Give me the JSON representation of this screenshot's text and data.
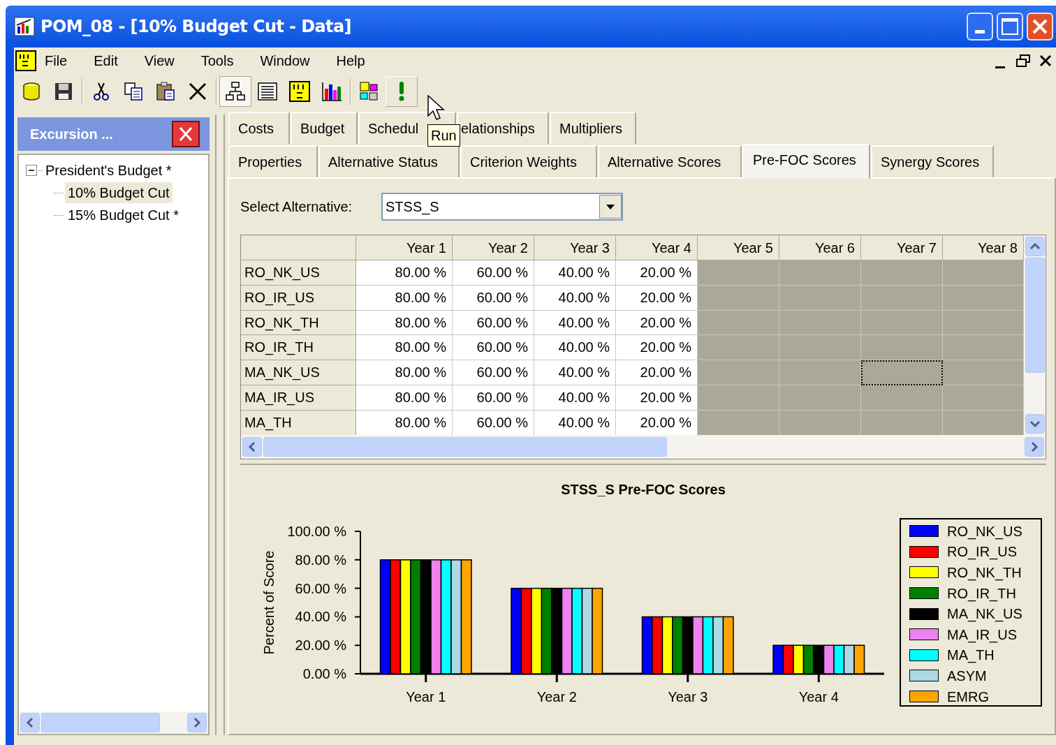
{
  "window": {
    "title": "POM_08 - [10% Budget Cut - Data]"
  },
  "menu": [
    "File",
    "Edit",
    "View",
    "Tools",
    "Window",
    "Help"
  ],
  "toolbar": [
    {
      "kind": "database",
      "pressed": false,
      "hovered": false
    },
    {
      "kind": "save",
      "pressed": false,
      "hovered": false
    },
    {
      "kind": "separator"
    },
    {
      "kind": "cut",
      "pressed": false,
      "hovered": false
    },
    {
      "kind": "copy",
      "pressed": false,
      "hovered": false
    },
    {
      "kind": "paste",
      "pressed": false,
      "hovered": false
    },
    {
      "kind": "delete",
      "pressed": false,
      "hovered": false
    },
    {
      "kind": "separator"
    },
    {
      "kind": "hierarchy",
      "pressed": true,
      "hovered": false
    },
    {
      "kind": "list",
      "pressed": false,
      "hovered": false
    },
    {
      "kind": "numbers",
      "pressed": false,
      "hovered": false
    },
    {
      "kind": "chart",
      "pressed": false,
      "hovered": false
    },
    {
      "kind": "separator"
    },
    {
      "kind": "layout",
      "pressed": false,
      "hovered": false
    },
    {
      "kind": "run",
      "pressed": false,
      "hovered": true
    }
  ],
  "tooltip": "Run",
  "excursion_panel": {
    "title": "Excursion ...",
    "tree": [
      {
        "label": "President's Budget *",
        "expanded": true,
        "selected": false,
        "children": [
          {
            "label": "10% Budget Cut",
            "selected": true
          },
          {
            "label": "15% Budget Cut *",
            "selected": false
          }
        ]
      }
    ]
  },
  "tabs": [
    [
      {
        "label": "Costs",
        "selected": false
      },
      {
        "label": "Budget",
        "selected": false
      },
      {
        "label": "Schedul",
        "selected": false
      },
      {
        "label": "elationships",
        "selected": false
      },
      {
        "label": "Multipliers",
        "selected": false
      }
    ],
    [
      {
        "label": "Properties",
        "selected": false
      },
      {
        "label": "Alternative Status",
        "selected": false
      },
      {
        "label": "Criterion Weights",
        "selected": false
      },
      {
        "label": "Alternative Scores",
        "selected": false
      },
      {
        "label": "Pre-FOC Scores",
        "selected": true
      },
      {
        "label": "Synergy Scores",
        "selected": false
      }
    ]
  ],
  "select_alternative": {
    "label": "Select Alternative:",
    "value": "STSS_S"
  },
  "grid": {
    "columns": [
      "Year 1",
      "Year 2",
      "Year 3",
      "Year 4",
      "Year 5",
      "Year 6",
      "Year 7",
      "Year 8"
    ],
    "rows": [
      {
        "name": "RO_NK_US",
        "values": [
          "80.00 %",
          "60.00 %",
          "40.00 %",
          "20.00 %"
        ],
        "focused": false
      },
      {
        "name": "RO_IR_US",
        "values": [
          "80.00 %",
          "60.00 %",
          "40.00 %",
          "20.00 %"
        ],
        "focused": false
      },
      {
        "name": "RO_NK_TH",
        "values": [
          "80.00 %",
          "60.00 %",
          "40.00 %",
          "20.00 %"
        ],
        "focused": false
      },
      {
        "name": "RO_IR_TH",
        "values": [
          "80.00 %",
          "60.00 %",
          "40.00 %",
          "20.00 %"
        ],
        "focused": false
      },
      {
        "name": "MA_NK_US",
        "values": [
          "80.00 %",
          "60.00 %",
          "40.00 %",
          "20.00 %"
        ],
        "focused": true
      },
      {
        "name": "MA_IR_US",
        "values": [
          "80.00 %",
          "60.00 %",
          "40.00 %",
          "20.00 %"
        ],
        "focused": false
      },
      {
        "name": "MA_TH",
        "values": [
          "80.00 %",
          "60.00 %",
          "40.00 %",
          "20.00 %"
        ],
        "focused": false
      }
    ]
  },
  "chart": {
    "chart_data": {
      "type": "bar",
      "title": "STSS_S Pre-FOC Scores",
      "ylabel": "Percent of Score",
      "categories": [
        "Year 1",
        "Year 2",
        "Year 3",
        "Year 4"
      ],
      "ylim": [
        0,
        100
      ],
      "yticks": [
        {
          "value": 0,
          "label": "0.00 %"
        },
        {
          "value": 20,
          "label": "20.00 %"
        },
        {
          "value": 40,
          "label": "40.00 %"
        },
        {
          "value": 60,
          "label": "60.00 %"
        },
        {
          "value": 80,
          "label": "80.00 %"
        },
        {
          "value": 100,
          "label": "100.00 %"
        }
      ],
      "series": [
        {
          "name": "RO_NK_US",
          "color": "#0000ff",
          "values": [
            80,
            60,
            40,
            20
          ]
        },
        {
          "name": "RO_IR_US",
          "color": "#ff0000",
          "values": [
            80,
            60,
            40,
            20
          ]
        },
        {
          "name": "RO_NK_TH",
          "color": "#ffff00",
          "values": [
            80,
            60,
            40,
            20
          ]
        },
        {
          "name": "RO_IR_TH",
          "color": "#008000",
          "values": [
            80,
            60,
            40,
            20
          ]
        },
        {
          "name": "MA_NK_US",
          "color": "#000000",
          "values": [
            80,
            60,
            40,
            20
          ]
        },
        {
          "name": "MA_IR_US",
          "color": "#ee82ee",
          "values": [
            80,
            60,
            40,
            20
          ]
        },
        {
          "name": "MA_TH",
          "color": "#00ffff",
          "values": [
            80,
            60,
            40,
            20
          ]
        },
        {
          "name": "ASYM",
          "color": "#add8e6",
          "values": [
            80,
            60,
            40,
            20
          ]
        },
        {
          "name": "EMRG",
          "color": "#ffa500",
          "values": [
            80,
            60,
            40,
            20
          ]
        }
      ]
    }
  }
}
